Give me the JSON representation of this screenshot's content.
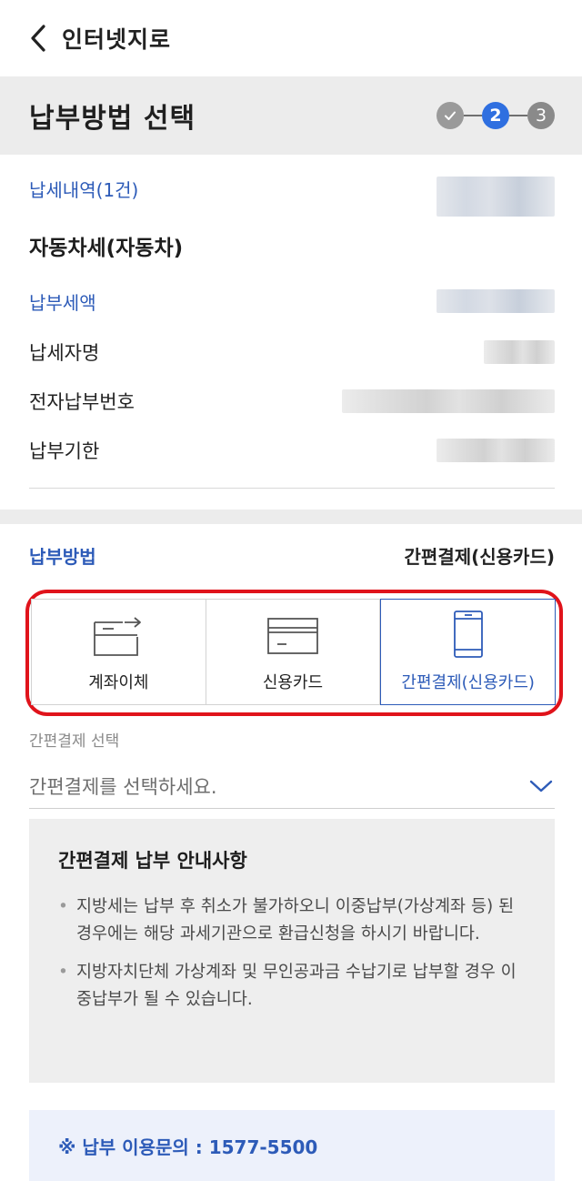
{
  "appbar": {
    "title": "인터넷지로"
  },
  "header": {
    "page_title": "납부방법 선택",
    "steps": [
      "2",
      "3"
    ]
  },
  "summary": {
    "items_label": "납세내역(1건)",
    "tax_name": "자동차세(자동차)",
    "amount_label": "납부세액",
    "payer_label": "납세자명",
    "epay_no_label": "전자납부번호",
    "due_label": "납부기한"
  },
  "method": {
    "label": "납부방법",
    "selected": "간편결제(신용카드)",
    "options": [
      {
        "label": "계좌이체",
        "icon": "bank-transfer-icon"
      },
      {
        "label": "신용카드",
        "icon": "credit-card-icon"
      },
      {
        "label": "간편결제(신용카드)",
        "icon": "mobile-phone-icon"
      }
    ]
  },
  "easypay": {
    "caption": "간편결제 선택",
    "placeholder": "간편결제를 선택하세요."
  },
  "notice": {
    "title": "간편결제 납부 안내사항",
    "items": [
      "지방세는 납부 후 취소가 불가하오니 이중납부(가상계좌 등) 된 경우에는 해당 과세기관으로 환급신청을 하시기 바랍니다.",
      "지방자치단체 가상계좌 및 무인공과금 수납기로 납부할 경우 이중납부가 될 수 있습니다."
    ]
  },
  "contact": {
    "text": "※ 납부 이용문의 : 1577-5500"
  },
  "colors": {
    "accent": "#2f6fe0",
    "label_blue": "#2d5bb8",
    "highlight": "#e0131b"
  }
}
